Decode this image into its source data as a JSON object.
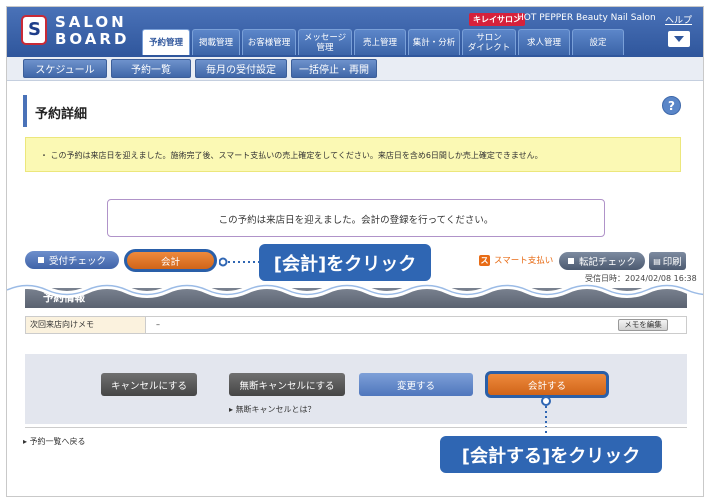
{
  "header": {
    "logo_text_1": "SALON",
    "logo_text_2": "BOARD",
    "brand_badge": "キレイサロン",
    "brand_name": "HOT PEPPER Beauty Nail Salon",
    "help_link": "ヘルプ",
    "nav_tabs": [
      {
        "label": "予約管理",
        "active": true
      },
      {
        "label": "掲載管理",
        "active": false
      },
      {
        "label": "お客様管理",
        "active": false
      },
      {
        "label": "メッセージ\n管理",
        "active": false
      },
      {
        "label": "売上管理",
        "active": false
      },
      {
        "label": "集計・分析",
        "active": false
      },
      {
        "label": "サロン\nダイレクト",
        "active": false
      },
      {
        "label": "求人管理",
        "active": false
      },
      {
        "label": "設定",
        "active": false
      }
    ]
  },
  "sub_nav": {
    "tabs": [
      "スケジュール",
      "予約一覧",
      "毎月の受付設定",
      "一括停止・再開"
    ]
  },
  "page": {
    "title": "予約詳細",
    "notice": "この予約は来店日を迎えました。施術完了後、スマート支払いの売上確定をしてください。来店日を含め6日間しか売上確定できません。",
    "message": "この予約は来店日を迎えました。会計の登録を行ってください。",
    "reception_check_label": "受付チェック",
    "checkout_top_label": "会計",
    "smart_pay_label": "スマート支払い",
    "smart_pay_icon": "ス",
    "transfer_check_label": "転記チェック",
    "print_label": "印刷",
    "received_at": "受信日時：2024/02/08 16:38",
    "section_title": "予約情報",
    "memo_label": "次回来店向けメモ",
    "memo_value": "–",
    "memo_edit_label": "メモを編集",
    "cancel_label": "キャンセルにする",
    "noshow_cancel_label": "無断キャンセルにする",
    "change_label": "変更する",
    "checkout_label": "会計する",
    "noshow_help": "無断キャンセルとは？",
    "back_link": "予約一覧へ戻る"
  },
  "callouts": {
    "top": "[会計]をクリック",
    "bottom": "[会計する]をクリック"
  },
  "colors": {
    "header_blue": "#2f569c",
    "accent_orange": "#e07020",
    "callout_blue": "#2f66b3",
    "notice_yellow": "#fbf9b4"
  }
}
